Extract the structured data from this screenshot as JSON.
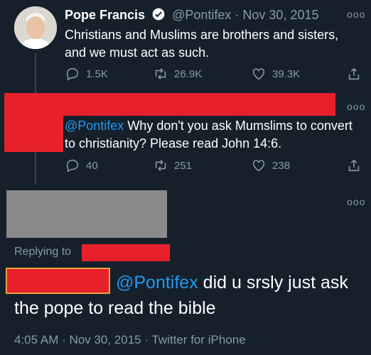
{
  "tweet1": {
    "author_name": "Pope Francis",
    "handle": "@Pontifex",
    "date": "Nov 30, 2015",
    "text_line1": "Christians and Muslims are brothers and sisters,",
    "text_line2": "and we must act as such.",
    "replies": "1.5K",
    "retweets": "26.9K",
    "likes": "39.3K",
    "more": "ooo"
  },
  "tweet2": {
    "mention": "@Pontifex",
    "text_line1_rest": " Why don't you ask Mumslims to convert",
    "text_line2": "to christianity? Please read John 14:6.",
    "replies": "40",
    "retweets": "251",
    "likes": "238",
    "more": "ooo"
  },
  "tweet3": {
    "replying_to": "Replying to",
    "mention": "@Pontifex",
    "text_line1_rest": " did u srsly just ask",
    "text_line2": "the pope to read the bible",
    "footer": "4:05 AM · Nov 30, 2015 · Twitter for iPhone",
    "more": "ooo"
  },
  "icons": [
    "verified-badge-icon",
    "reply-icon",
    "retweet-icon",
    "like-icon",
    "share-icon",
    "more-icon"
  ],
  "colors": {
    "background": "#15202b",
    "link": "#1d9bf0",
    "muted": "#8899a6",
    "redaction": "#e8202c"
  }
}
